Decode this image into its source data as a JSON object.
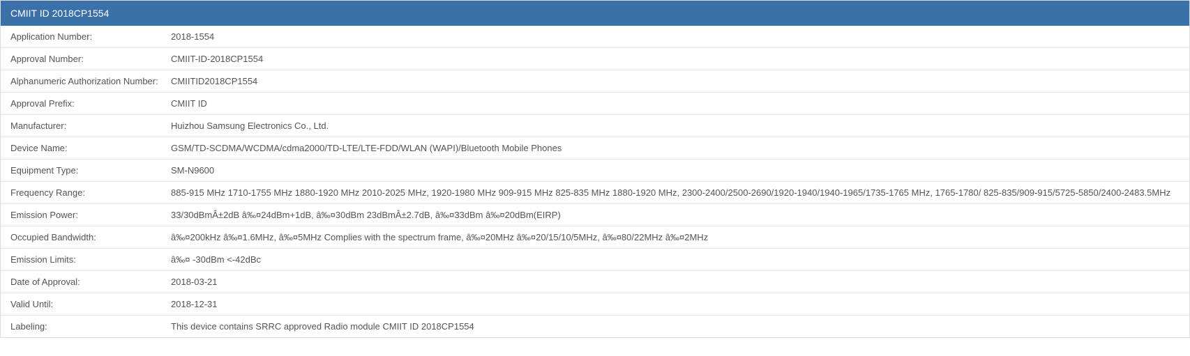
{
  "header": {
    "title": "CMIIT ID 2018CP1554"
  },
  "rows": [
    {
      "label": "Application Number:",
      "value": "2018-1554"
    },
    {
      "label": "Approval Number:",
      "value": "CMIIT-ID-2018CP1554"
    },
    {
      "label": "Alphanumeric Authorization Number:",
      "value": "CMIITID2018CP1554"
    },
    {
      "label": "Approval Prefix:",
      "value": "CMIIT ID"
    },
    {
      "label": "Manufacturer:",
      "value": "Huizhou Samsung Electronics Co., Ltd."
    },
    {
      "label": "Device Name:",
      "value": "GSM/TD-SCDMA/WCDMA/cdma2000/TD-LTE/LTE-FDD/WLAN (WAPI)/Bluetooth Mobile Phones"
    },
    {
      "label": "Equipment Type:",
      "value": "SM-N9600"
    },
    {
      "label": "Frequency Range:",
      "value": "885-915 MHz 1710-1755 MHz 1880-1920 MHz 2010-2025 MHz, 1920-1980 MHz 909-915 MHz 825-835 MHz 1880-1920 MHz, 2300-2400/2500-2690/1920-1940/1940-1965/1735-1765 MHz, 1765-1780/ 825-835/909-915/5725-5850/2400-2483.5MHz"
    },
    {
      "label": "Emission Power:",
      "value": "33/30dBmÂ±2dB â‰¤24dBm+1dB, â‰¤30dBm 23dBmÂ±2.7dB, â‰¤33dBm â‰¤20dBm(EIRP)"
    },
    {
      "label": "Occupied Bandwidth:",
      "value": "â‰¤200kHz â‰¤1.6MHz, â‰¤5MHz Complies with the spectrum frame, â‰¤20MHz â‰¤20/15/10/5MHz, â‰¤80/22MHz â‰¤2MHz"
    },
    {
      "label": "Emission Limits:",
      "value": "â‰¤ -30dBm <-42dBc"
    },
    {
      "label": "Date of Approval:",
      "value": "2018-03-21"
    },
    {
      "label": "Valid Until:",
      "value": "2018-12-31"
    },
    {
      "label": "Labeling:",
      "value": "This device contains SRRC approved Radio module CMIIT ID 2018CP1554"
    }
  ]
}
